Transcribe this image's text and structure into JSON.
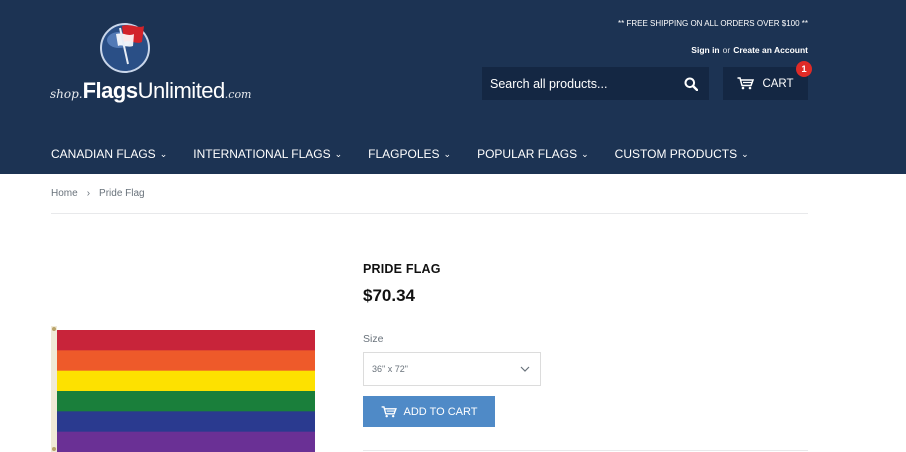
{
  "header": {
    "logo": {
      "prefix": "shop.",
      "brand_bold": "Flags",
      "brand_regular": "Unlimited",
      "suffix": ".com"
    },
    "promo_text": "** FREE SHIPPING ON ALL ORDERS OVER $100 **",
    "account": {
      "sign_in": "Sign in",
      "or": "or",
      "create": "Create an Account"
    },
    "search": {
      "placeholder": "Search all products..."
    },
    "cart": {
      "label": "CART",
      "count": "1"
    }
  },
  "nav": {
    "items": [
      {
        "label": "CANADIAN FLAGS"
      },
      {
        "label": "INTERNATIONAL FLAGS"
      },
      {
        "label": "FLAGPOLES"
      },
      {
        "label": "POPULAR FLAGS"
      },
      {
        "label": "CUSTOM PRODUCTS"
      }
    ]
  },
  "breadcrumb": {
    "home": "Home",
    "separator": "›",
    "current": "Pride Flag"
  },
  "product": {
    "title": "PRIDE FLAG",
    "price": "$70.34",
    "size_label": "Size",
    "size_selected": "36\" x 72\"",
    "add_to_cart": "ADD TO CART",
    "flag_stripes": [
      "#c8243a",
      "#ee5a2a",
      "#fde100",
      "#1a7f3b",
      "#2a3a8f",
      "#6a3095"
    ]
  },
  "colors": {
    "header_bg": "#1c3353",
    "control_bg": "#142743",
    "button": "#4f8ac7",
    "badge": "#e02b27"
  }
}
